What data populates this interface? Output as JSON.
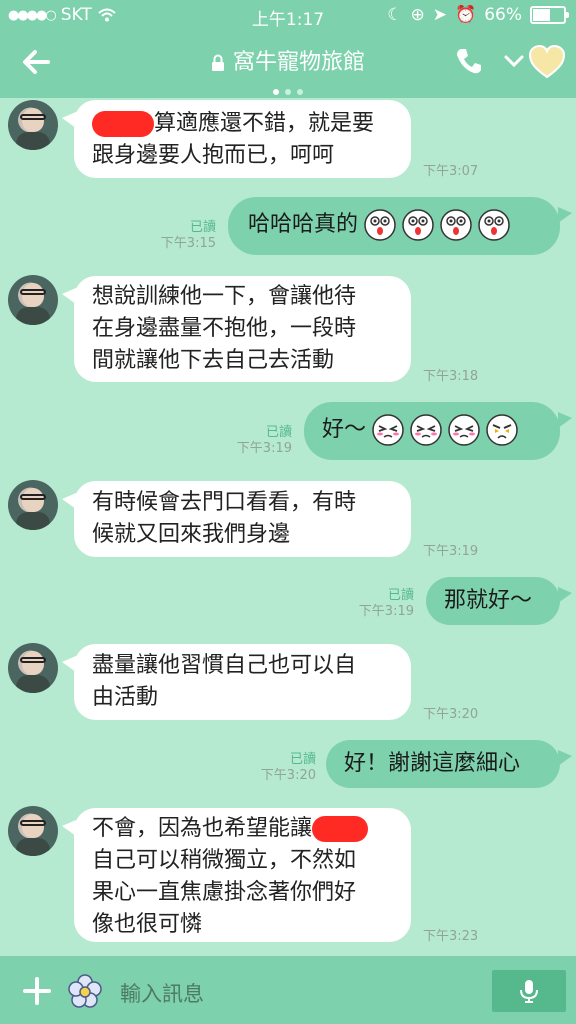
{
  "status": {
    "carrier": "SKT",
    "time": "上午1:17",
    "battery": "66%",
    "battery_level": 0.66
  },
  "header": {
    "title": "窩牛寵物旅館"
  },
  "messages": [
    {
      "dir": "in",
      "text": "算適應還不錯，就是要跟身邊要人抱而已，呵呵",
      "line1": "算適應還不錯，就是要",
      "line2": "跟身邊要人抱而已，呵呵",
      "time": "下午3:07"
    },
    {
      "dir": "out",
      "text": "哈哈哈真的",
      "read": "已讀",
      "time": "下午3:15"
    },
    {
      "dir": "in",
      "line1": "想說訓練他一下，會讓他待",
      "line2": "在身邊盡量不抱他，一段時",
      "line3": "間就讓他下去自己去活動",
      "time": "下午3:18"
    },
    {
      "dir": "out",
      "text": "好～",
      "read": "已讀",
      "time": "下午3:19"
    },
    {
      "dir": "in",
      "line1": "有時候會去門口看看，有時",
      "line2": "候就又回來我們身邊",
      "time": "下午3:19"
    },
    {
      "dir": "out",
      "text": "那就好～",
      "read": "已讀",
      "time": "下午3:19"
    },
    {
      "dir": "in",
      "line1": "盡量讓他習慣自己也可以自",
      "line2": "由活動",
      "time": "下午3:20"
    },
    {
      "dir": "out",
      "text": "好！謝謝這麼細心",
      "read": "已讀",
      "time": "下午3:20"
    },
    {
      "dir": "in",
      "line1": "不會，因為也希望能讓",
      "line2": "自己可以稍微獨立，不然如",
      "line3": "果心一直焦慮掛念著你們好",
      "line4": "像也很可憐",
      "time": "下午3:23"
    }
  ],
  "input": {
    "placeholder": "輸入訊息"
  },
  "colors": {
    "accent": "#7dd2ad",
    "background": "#b6ead0",
    "redaction": "#ff2a24"
  }
}
